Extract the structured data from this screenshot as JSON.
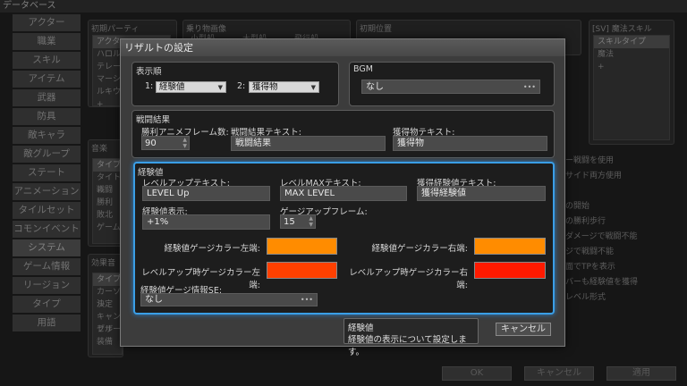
{
  "app": {
    "title": "データベース"
  },
  "sidebar": {
    "items": [
      {
        "label": "アクター"
      },
      {
        "label": "職業"
      },
      {
        "label": "スキル"
      },
      {
        "label": "アイテム"
      },
      {
        "label": "武器"
      },
      {
        "label": "防具"
      },
      {
        "label": "敵キャラ"
      },
      {
        "label": "敵グループ"
      },
      {
        "label": "ステート"
      },
      {
        "label": "アニメーション"
      },
      {
        "label": "タイルセット"
      },
      {
        "label": "コモンイベント"
      },
      {
        "label": "システム"
      },
      {
        "label": "ゲーム情報"
      },
      {
        "label": "リージョン"
      },
      {
        "label": "タイプ"
      },
      {
        "label": "用語"
      }
    ]
  },
  "background": {
    "initial_party_label": "初期パーティ",
    "initial_party_rows": [
      "アクター",
      "ハロルド",
      "テレーゼ",
      "マーシャ",
      "ルキウス",
      "+"
    ],
    "vehicle_label": "乗り物画像",
    "vehicle_cols": [
      "小型船",
      "大型船",
      "飛行船"
    ],
    "start_pos_label": "初期位置",
    "magic_skill_label": "[SV] 魔法スキル",
    "magic_rows": [
      "スキルタイプ",
      "魔法",
      "+"
    ],
    "music_label": "音楽",
    "music_rows": [
      "タイプ",
      "タイトル",
      "戦闘",
      "勝利",
      "敗北",
      "ゲーム"
    ],
    "se_label": "効果音",
    "se_rows": [
      "タイプ",
      "カーソル",
      "決定",
      "キャンセル",
      "ブザー",
      "装備"
    ],
    "options": [
      "ー戦闘を使用",
      "サイド両方使用",
      "",
      "の開始",
      "の勝利歩行",
      "ダメージで戦闘不能",
      "ジで戦闘不能",
      "面でTPを表示",
      "バーも経験値を獲得",
      "レベル形式"
    ],
    "footer": {
      "ok": "OK",
      "cancel": "キャンセル",
      "apply": "適用"
    }
  },
  "dialog": {
    "title": "リザルトの設定",
    "display_order": {
      "label": "表示順",
      "slot1_num": "1:",
      "slot1_value": "経験値",
      "slot2_num": "2:",
      "slot2_value": "獲得物"
    },
    "bgm": {
      "label": "BGM",
      "value": "なし"
    },
    "battle_result": {
      "label": "戦闘結果",
      "victory_frames_label": "勝利アニメフレーム数:",
      "victory_frames_value": "90",
      "result_text_label": "戦闘結果テキスト:",
      "result_text_value": "戦闘結果",
      "loot_text_label": "獲得物テキスト:",
      "loot_text_value": "獲得物"
    },
    "exp": {
      "label": "経験値",
      "levelup_text_label": "レベルアップテキスト:",
      "levelup_text_value": "LEVEL Up",
      "levelmax_text_label": "レベルMAXテキスト:",
      "levelmax_text_value": "MAX LEVEL",
      "gained_exp_text_label": "獲得経験値テキスト:",
      "gained_exp_text_value": "獲得経験値",
      "exp_display_label": "経験値表示:",
      "exp_display_value": "+1%",
      "gauge_frames_label": "ゲージアップフレーム:",
      "gauge_frames_value": "15",
      "gauge_left_label": "経験値ゲージカラー左端:",
      "gauge_left_color": "#ff8c00",
      "gauge_right_label": "経験値ゲージカラー右端:",
      "gauge_right_color": "#ff8c00",
      "lvup_left_label": "レベルアップ時ゲージカラー左端:",
      "lvup_left_color": "#ff4000",
      "lvup_right_label": "レベルアップ時ゲージカラー右端:",
      "lvup_right_color": "#ff1a00",
      "gauge_se_label": "経験値ゲージ情報SE:",
      "gauge_se_value": "なし"
    },
    "tooltip": {
      "title": "経験値",
      "body": "経験値の表示について設定します。"
    },
    "cancel_button": "キャンセル"
  }
}
